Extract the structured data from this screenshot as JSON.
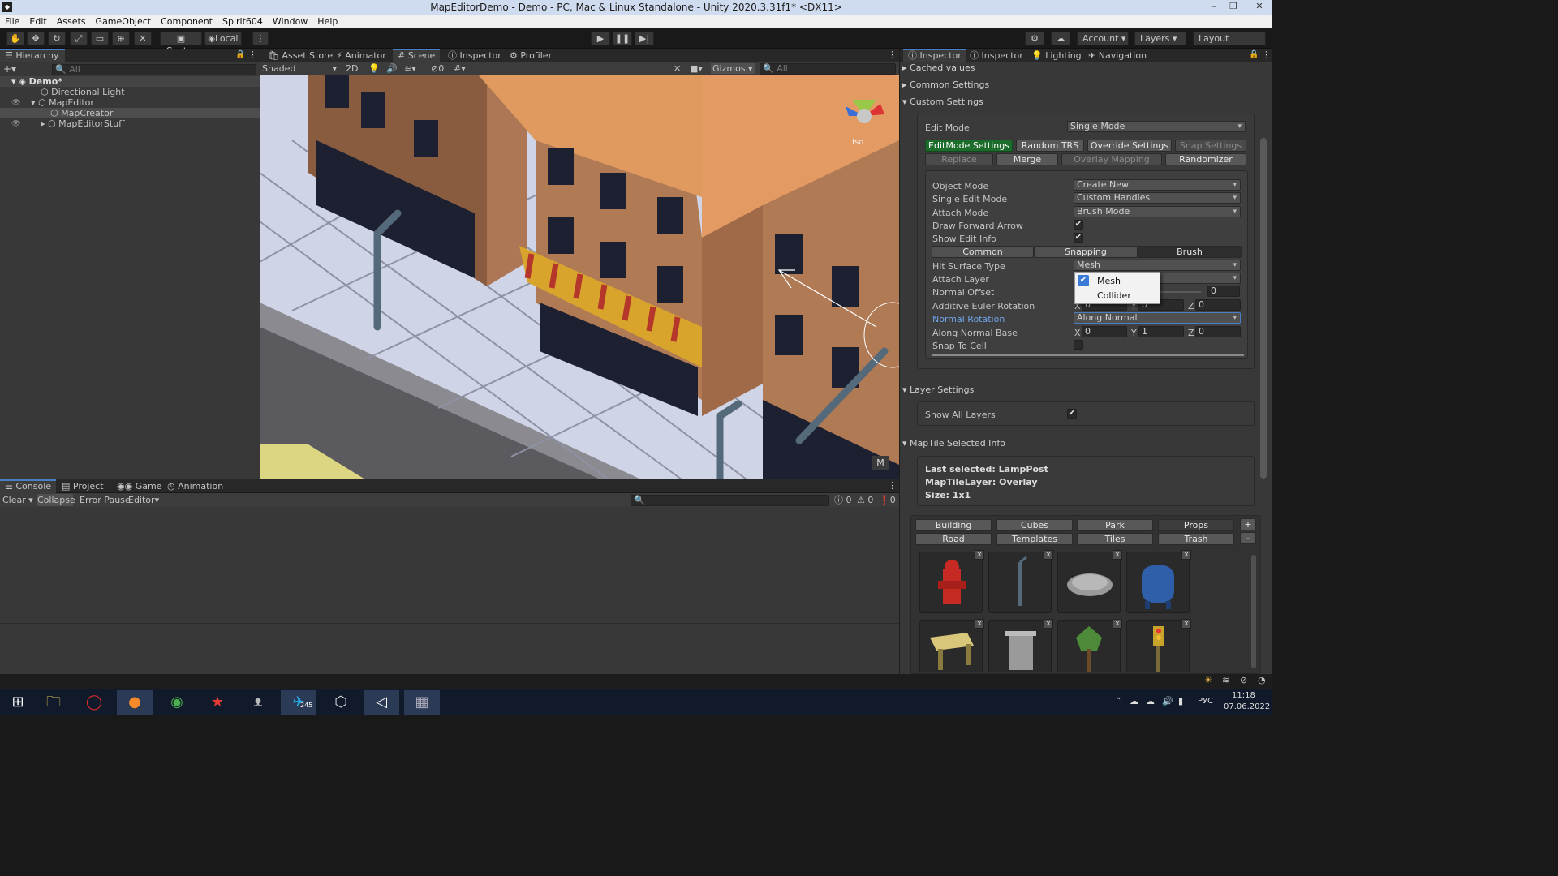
{
  "window": {
    "title": "MapEditorDemo - Demo - PC, Mac & Linux Standalone - Unity 2020.3.31f1* <DX11>"
  },
  "menu": [
    "File",
    "Edit",
    "Assets",
    "GameObject",
    "Component",
    "Spirit604",
    "Window",
    "Help"
  ],
  "toolbar": {
    "center_label": "Center",
    "local_label": "Local",
    "account_label": "Account",
    "layers_label": "Layers",
    "layout_label": "Layout"
  },
  "hierarchy": {
    "tab": "Hierarchy",
    "search_placeholder": "All",
    "items": [
      {
        "label": "Demo*"
      },
      {
        "label": "Directional Light"
      },
      {
        "label": "MapEditor"
      },
      {
        "label": "MapCreator"
      },
      {
        "label": "MapEditorStuff"
      }
    ]
  },
  "scene": {
    "tabs": [
      "Asset Store",
      "Animator",
      "Scene",
      "Inspector",
      "Profiler"
    ],
    "shading": "Shaded",
    "mode_2d": "2D",
    "hidden_count": "0",
    "gizmos": "Gizmos",
    "search_placeholder": "All",
    "iso_label": "Iso",
    "m_button": "M"
  },
  "console": {
    "tabs": [
      "Console",
      "Project",
      "Game",
      "Animation"
    ],
    "clear": "Clear",
    "collapse": "Collapse",
    "error_pause": "Error Pause",
    "editor": "Editor",
    "info_count": "0",
    "warn_count": "0",
    "error_count": "0"
  },
  "inspector": {
    "tabs": [
      "Inspector",
      "Inspector",
      "Lighting",
      "Navigation"
    ],
    "sections": {
      "cached": "Cached values",
      "common": "Common Settings",
      "custom": "Custom Settings",
      "layer": "Layer Settings",
      "maptile": "MapTile Selected Info"
    },
    "edit_mode_label": "Edit Mode",
    "edit_mode_value": "Single Mode",
    "mode_buttons_row1": [
      "EditMode Settings",
      "Random TRS",
      "Override Settings",
      "Snap Settings"
    ],
    "mode_buttons_row2": [
      "Replace",
      "Merge",
      "Overlay Mapping",
      "Randomizer"
    ],
    "fields": {
      "object_mode": {
        "label": "Object Mode",
        "value": "Create New"
      },
      "single_edit_mode": {
        "label": "Single Edit Mode",
        "value": "Custom Handles"
      },
      "attach_mode": {
        "label": "Attach Mode",
        "value": "Brush Mode"
      },
      "draw_forward_arrow": {
        "label": "Draw Forward Arrow",
        "checked": "✔"
      },
      "show_edit_info": {
        "label": "Show Edit Info",
        "checked": "✔"
      },
      "hit_surface_type": {
        "label": "Hit Surface Type",
        "value": "Mesh"
      },
      "attach_layer": {
        "label": "Attach Layer"
      },
      "normal_offset": {
        "label": "Normal Offset",
        "value": "0"
      },
      "additive_euler": {
        "label": "Additive Euler Rotation",
        "x": "0",
        "y": "0",
        "z": "0"
      },
      "normal_rotation": {
        "label": "Normal Rotation",
        "value": "Along Normal"
      },
      "along_normal_base": {
        "label": "Along Normal Base",
        "x": "0",
        "y": "1",
        "z": "0"
      },
      "snap_to_cell": {
        "label": "Snap To Cell"
      }
    },
    "sub_tabs": [
      "Common",
      "Snapping",
      "Brush"
    ],
    "dropdown_popup": {
      "options": [
        "Mesh",
        "Collider"
      ],
      "checkmark": "✔"
    },
    "axis": {
      "x": "X",
      "y": "Y",
      "z": "Z"
    },
    "show_all_layers": {
      "label": "Show All Layers",
      "checked": "✔"
    },
    "maptile_info": {
      "last_selected": "Last selected: LampPost",
      "layer": "MapTileLayer: Overlay",
      "size": "Size: 1x1"
    },
    "categories_row1": [
      "Building",
      "Cubes",
      "Park",
      "Props"
    ],
    "categories_row2": [
      "Road",
      "Templates",
      "Tiles",
      "Trash"
    ],
    "plus": "+",
    "minus": "-",
    "thumb_close": "x"
  },
  "taskbar": {
    "language": "РУС",
    "time": "11:18",
    "date": "07.06.2022",
    "telegram_badge": "245"
  }
}
